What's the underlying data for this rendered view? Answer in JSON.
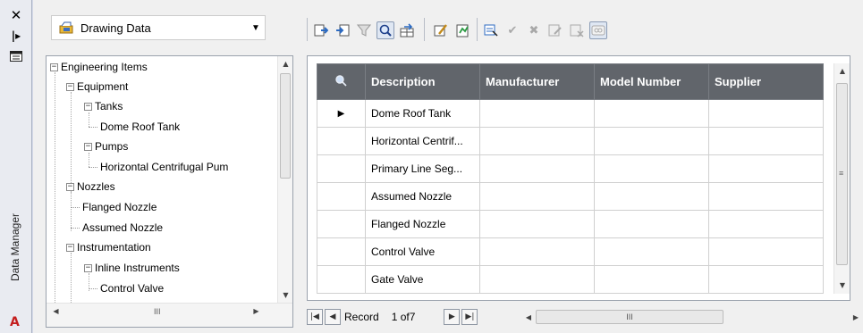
{
  "palette": {
    "title": "Data Manager",
    "close_icon": "close-icon",
    "logo_text": "A"
  },
  "view_select": {
    "value": "Drawing Data"
  },
  "tree": {
    "nodes": [
      {
        "label": "Engineering Items",
        "expanded": true
      },
      {
        "label": "Equipment",
        "expanded": true
      },
      {
        "label": "Tanks",
        "expanded": true
      },
      {
        "label": "Dome Roof Tank"
      },
      {
        "label": "Pumps",
        "expanded": true
      },
      {
        "label": "Horizontal Centrifugal Pum"
      },
      {
        "label": "Nozzles",
        "expanded": true
      },
      {
        "label": "Flanged Nozzle"
      },
      {
        "label": "Assumed Nozzle"
      },
      {
        "label": "Instrumentation",
        "expanded": true
      },
      {
        "label": "Inline Instruments",
        "expanded": true
      },
      {
        "label": "Control Valve"
      }
    ]
  },
  "grid": {
    "columns": [
      "Description",
      "Manufacturer",
      "Model Number",
      "Supplier"
    ],
    "rows": [
      {
        "description": "Dome Roof Tank",
        "current": true
      },
      {
        "description": "Horizontal Centrif..."
      },
      {
        "description": "Primary Line Seg..."
      },
      {
        "description": "Assumed Nozzle"
      },
      {
        "description": "Flanged Nozzle"
      },
      {
        "description": "Control Valve"
      },
      {
        "description": "Gate Valve"
      }
    ]
  },
  "record_nav": {
    "label": "Record",
    "position": "1 of7"
  },
  "colors": {
    "header_bg": "#61656b",
    "panel_bg": "#f0f0f0",
    "logo_red": "#c41e1e"
  }
}
